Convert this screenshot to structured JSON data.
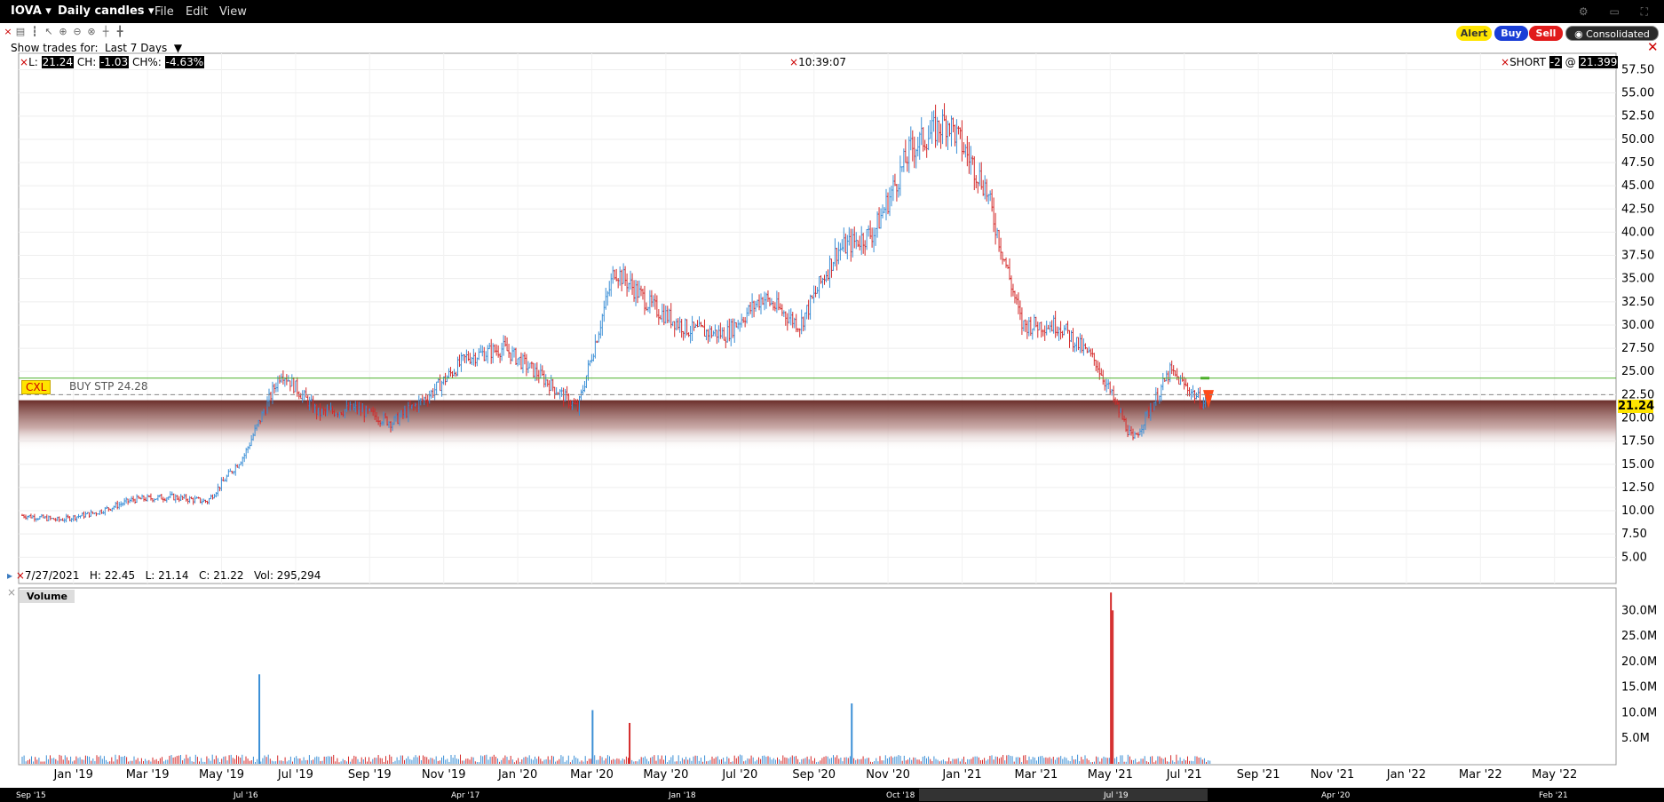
{
  "window": {
    "symbol": "IOVA",
    "chart_type_label": "Daily candles",
    "menus": [
      "File",
      "Edit",
      "View"
    ]
  },
  "toolbar": {
    "show_trades_label": "Show trades for:",
    "show_trades_value": "Last 7 Days",
    "alert_label": "Alert",
    "buy_label": "Buy",
    "sell_label": "Sell",
    "consolidated_label": "Consolidated"
  },
  "quote": {
    "last_label": "L:",
    "last_value": "21.24",
    "change_label": "CH:",
    "change_value": "-1.03",
    "change_pct_label": "CH%:",
    "change_pct_value": "-4.63%",
    "time": "10:39:07",
    "position_label": "SHORT",
    "position_qty": "-2",
    "position_at": "@",
    "position_price": "21.399",
    "current_price_tag": "21.24"
  },
  "order": {
    "cancel_label": "CXL",
    "label": "BUY STP 24.28",
    "price": 24.28
  },
  "bar_info": {
    "date": "7/27/2021",
    "high": "H: 22.45",
    "low": "L: 21.14",
    "close": "C: 21.22",
    "volume": "Vol: 295,294"
  },
  "volume_panel": {
    "label": "Volume"
  },
  "colors": {
    "up": "#3b8fd6",
    "down": "#d42a2a",
    "order_line": "#4caf2a",
    "price_tag": "#ffe400",
    "band": "#6b2e2a"
  },
  "chart_data": [
    {
      "type": "candlestick",
      "title": "",
      "y_ticks": [
        "5.00",
        "7.50",
        "10.00",
        "12.50",
        "15.00",
        "17.50",
        "20.00",
        "22.50",
        "25.00",
        "27.50",
        "30.00",
        "32.50",
        "35.00",
        "37.50",
        "40.00",
        "42.50",
        "45.00",
        "47.50",
        "50.00",
        "52.50",
        "55.00",
        "57.50"
      ],
      "ylim": [
        3.5,
        58.5
      ],
      "x_ticks": [
        "Jan '19",
        "Mar '19",
        "May '19",
        "Jul '19",
        "Sep '19",
        "Nov '19",
        "Jan '20",
        "Mar '20",
        "May '20",
        "Jul '20",
        "Sep '20",
        "Nov '20",
        "Jan '21",
        "Mar '21",
        "May '21",
        "Jul '21",
        "Sep '21",
        "Nov '21",
        "Jan '22",
        "Mar '22",
        "May '22"
      ],
      "close_series": {
        "x": [
          "2018-12",
          "2019-01",
          "2019-02",
          "2019-03",
          "2019-04",
          "2019-05",
          "2019-06",
          "2019-07",
          "2019-08",
          "2019-09",
          "2019-10",
          "2019-11",
          "2019-12",
          "2020-01",
          "2020-02",
          "2020-03",
          "2020-04",
          "2020-05",
          "2020-06",
          "2020-07",
          "2020-08",
          "2020-09",
          "2020-10",
          "2020-11",
          "2020-12",
          "2021-01",
          "2021-02",
          "2021-03",
          "2021-04",
          "2021-05",
          "2021-06",
          "2021-07"
        ],
        "values": [
          9.5,
          9.0,
          9.8,
          11.2,
          11.5,
          11.0,
          16.0,
          25.0,
          20.5,
          21.0,
          19.5,
          22.5,
          26.5,
          27.5,
          24.5,
          21.0,
          36.0,
          32.0,
          29.5,
          29.0,
          33.0,
          30.0,
          38.0,
          40.0,
          49.0,
          52.0,
          45.0,
          30.0,
          30.0,
          26.0,
          17.5,
          25.0,
          21.2
        ]
      },
      "order_line": 24.28,
      "last_price": 21.24
    },
    {
      "type": "bar",
      "title": "Volume",
      "y_ticks": [
        "5.0M",
        "10.0M",
        "15.0M",
        "20.0M",
        "25.0M",
        "30.0M"
      ],
      "ylim": [
        0,
        33000000
      ],
      "spikes": [
        {
          "x": "2019-06",
          "value": 17500000
        },
        {
          "x": "2020-03",
          "value": 10500000
        },
        {
          "x": "2020-04",
          "value": 8000000
        },
        {
          "x": "2020-10",
          "value": 11800000
        },
        {
          "x": "2021-05",
          "value": 33500000
        },
        {
          "x": "2021-05",
          "value": 30000000
        }
      ]
    }
  ],
  "scroller_labels": [
    "Sep '15",
    "Jul '16",
    "Apr '17",
    "Jan '18",
    "Oct '18",
    "Jul '19",
    "Apr '20",
    "Feb '21"
  ]
}
